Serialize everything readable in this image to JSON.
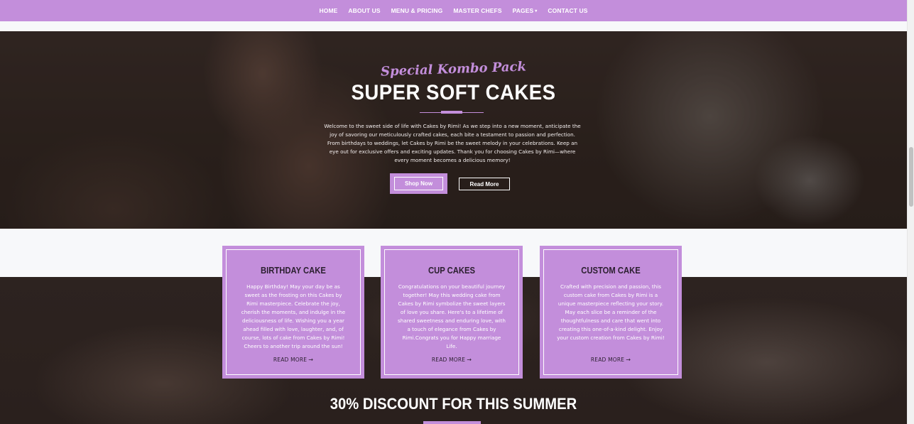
{
  "nav": {
    "items": [
      {
        "label": "HOME"
      },
      {
        "label": "ABOUT US"
      },
      {
        "label": "MENU & PRICING"
      },
      {
        "label": "MASTER CHEFS"
      },
      {
        "label": "PAGES",
        "has_dropdown": true
      },
      {
        "label": "CONTACT US"
      }
    ],
    "dropdown_caret": "▾",
    "background": "#c38edb"
  },
  "hero": {
    "subtitle": "Special Kombo Pack",
    "title": "SUPER SOFT CAKES",
    "description": "Welcome to the sweet side of life with Cakes by Rimi! As we step into a new moment, anticipate the joy of savoring our meticulously crafted cakes, each bite a testament to passion and perfection. From birthdays to weddings, let Cakes by Rimi be the sweet melody in your celebrations. Keep an eye out for exclusive offers and exciting updates. Thank you for choosing Cakes by Rimi—where every moment becomes a delicious memory!",
    "primary_button": "Shop Now",
    "secondary_button": "Read More"
  },
  "cards": [
    {
      "title": "BIRTHDAY CAKE",
      "text": "Happy Birthday! May your day be as sweet as the frosting on this Cakes by Rimi masterpiece. Celebrate the joy, cherish the moments, and indulge in the deliciousness of life. Wishing you a year ahead filled with love, laughter, and, of course, lots of cake from Cakes by Rimi! Cheers to another trip around the sun!",
      "link": "READ MORE"
    },
    {
      "title": "CUP CAKES",
      "text": "Congratulations on your beautiful journey together! May this wedding cake from Cakes by Rimi symbolize the sweet layers of love you share. Here's to a lifetime of shared sweetness and enduring love, with a touch of elegance from Cakes by Rimi.Congrats you for Happy marriage Life.",
      "link": "READ MORE"
    },
    {
      "title": "CUSTOM CAKE",
      "text": "Crafted with precision and passion, this custom cake from Cakes by Rimi is a unique masterpiece reflecting your story. May each slice be a reminder of the thoughtfulness and care that went into creating this one-of-a-kind delight. Enjoy your custom creation from Cakes by Rimi!",
      "link": "READ MORE"
    }
  ],
  "link_arrow": "→",
  "discount": {
    "title": "30% DISCOUNT FOR THIS SUMMER"
  },
  "colors": {
    "accent": "#c38edb",
    "card_title": "#2b1f2f",
    "white": "#ffffff"
  }
}
